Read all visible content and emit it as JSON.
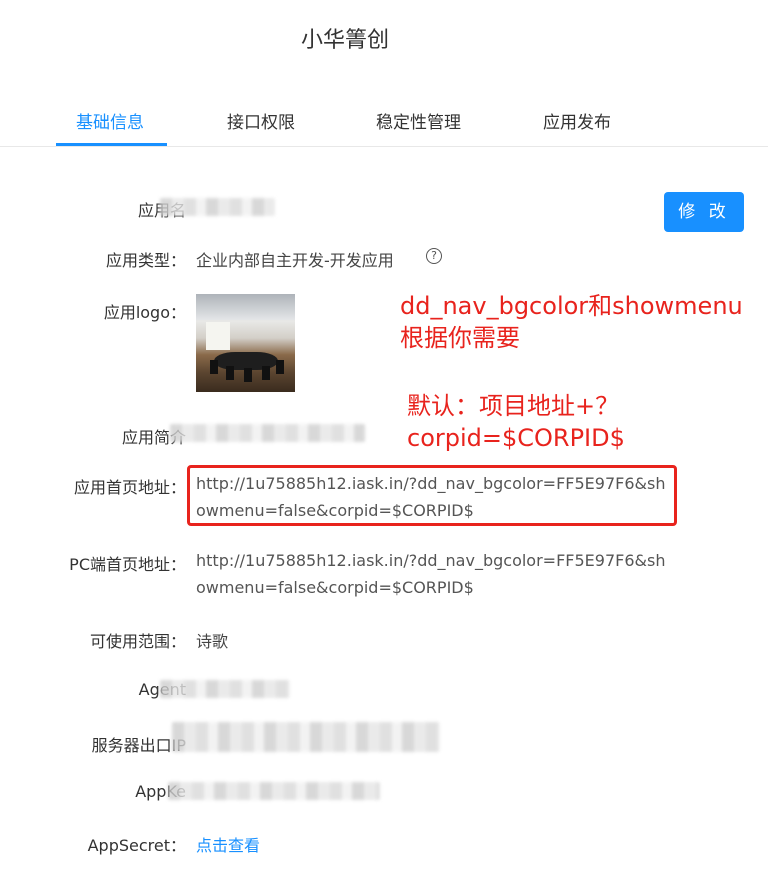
{
  "app_title": "小华箐创",
  "tabs": [
    {
      "label": "基础信息",
      "active": true
    },
    {
      "label": "接口权限",
      "active": false
    },
    {
      "label": "稳定性管理",
      "active": false
    },
    {
      "label": "应用发布",
      "active": false
    }
  ],
  "edit_button": "修 改",
  "fields": {
    "app_name_label": "应用名",
    "app_type_label": "应用类型：",
    "app_type_value": "企业内部自主开发-开发应用",
    "logo_label": "应用logo：",
    "desc_label": "应用简介",
    "homepage_label": "应用首页地址：",
    "homepage_url": "http://1u75885h12.iask.in/?dd_nav_bgcolor=FF5E97F6&showmenu=false&corpid=$CORPID$",
    "pc_homepage_label": "PC端首页地址：",
    "pc_homepage_url": "http://1u75885h12.iask.in/?dd_nav_bgcolor=FF5E97F6&showmenu=false&corpid=$CORPID$",
    "scope_label": "可使用范围：",
    "scope_value": "诗歌",
    "agentid_label": "Agent",
    "server_ip_label": "服务器出口IP",
    "appkey_label": "AppKe",
    "appsecret_label": "AppSecret：",
    "appsecret_link": "点击查看"
  },
  "annotation": {
    "line1": "dd_nav_bgcolor和showmenu",
    "line2": "根据你需要",
    "line3": "默认：项目地址+？",
    "line4": "corpid=$CORPID$"
  },
  "colors": {
    "accent": "#1890ff",
    "annotation_red": "#e8231d"
  },
  "icons": {
    "help": "question-circle-icon"
  }
}
